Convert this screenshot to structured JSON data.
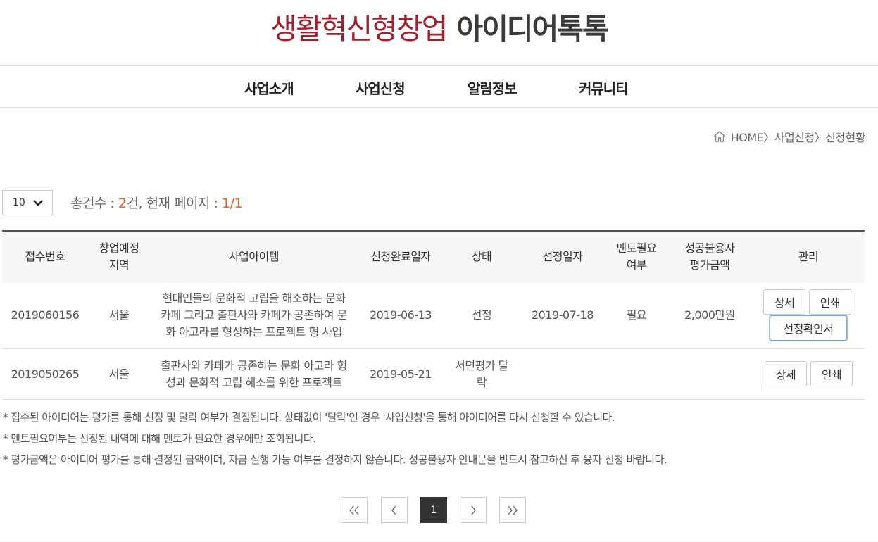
{
  "header": {
    "logo_red": "생활혁신형창업",
    "logo_dark": "아이디어톡톡"
  },
  "nav": [
    "사업소개",
    "사업신청",
    "알림정보",
    "커뮤니티"
  ],
  "breadcrumb": "HOME〉사업신청〉신청현황",
  "list": {
    "page_size": "10",
    "count_prefix": "총건수 : ",
    "count_value": "2",
    "count_mid": "건, 현재 페이지 : ",
    "page_value": "1/1"
  },
  "table": {
    "headers": [
      "접수번호",
      "창업예정\n지역",
      "사업아이템",
      "신청완료일자",
      "상태",
      "선정일자",
      "멘토필요\n여부",
      "성공불용자\n평가금액",
      "관리"
    ],
    "rows": [
      {
        "id": "2019060156",
        "region": "서울",
        "item": "현대인들의 문화적 고립을 해소하는 문화\n카페 그리고 출판사와 카페가 공존하여 문\n화 아고라를 형성하는 프로젝트 형 사업",
        "submitted": "2019-06-13",
        "status": "선정",
        "selected": "2019-07-18",
        "mentor": "필요",
        "amount": "2,000만원",
        "buttons": [
          "상세",
          "인쇄",
          "선정확인서"
        ]
      },
      {
        "id": "2019050265",
        "region": "서울",
        "item": "출판사와 카페가 공존하는 문화 아고라 형\n성과 문화적 고립 해소를 위한 프로젝트",
        "submitted": "2019-05-21",
        "status": "서면평가 탈\n락",
        "selected": "",
        "mentor": "",
        "amount": "",
        "buttons": [
          "상세",
          "인쇄"
        ]
      }
    ]
  },
  "notes": [
    "* 접수된 아이디어는 평가를 통해 선정 및 탈락 여부가 결정됩니다. 상태값이 '탈락'인 경우 '사업신청'을 통해 아이디어를 다시 신청할 수 있습니다.",
    "* 멘토필요여부는 선정된 내역에 대해 멘토가 필요한 경우에만 조회됩니다.",
    "* 평가금액은 아이디어 평가를 통해 결정된 금액이며, 자금 실행 가능 여부를 결정하지 않습니다. 성공불용자 안내문을 반드시 참고하신 후 융자 신청 바랍니다."
  ],
  "pagination": {
    "first": "《",
    "prev": "〈",
    "current": "1",
    "next": "〉",
    "last": "》"
  },
  "colors": {
    "logo_red": "#a31f2d",
    "accent_orange": "#e0622a",
    "active_page": "#333333"
  }
}
